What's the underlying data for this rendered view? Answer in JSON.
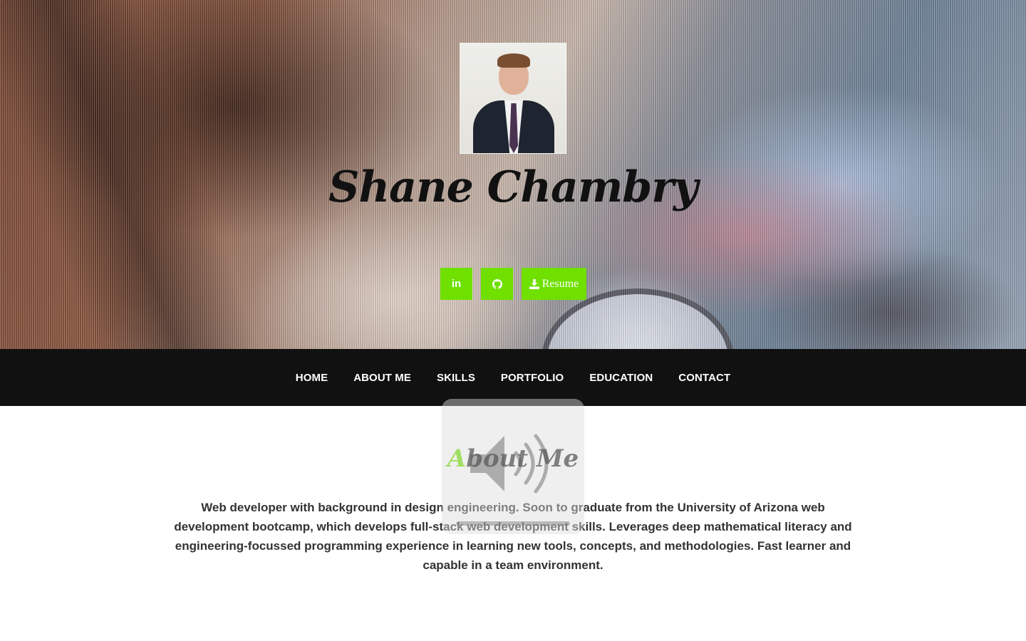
{
  "hero": {
    "name": "Shane Chambry",
    "linkedin_label": "in",
    "resume_label": "Resume",
    "linkedin_icon": "linkedin-icon",
    "github_icon": "github-icon",
    "download_icon": "download-icon"
  },
  "nav": {
    "items": [
      {
        "label": "HOME"
      },
      {
        "label": "ABOUT ME"
      },
      {
        "label": "SKILLS"
      },
      {
        "label": "PORTFOLIO"
      },
      {
        "label": "EDUCATION"
      },
      {
        "label": "CONTACT"
      }
    ]
  },
  "about": {
    "title_first_letter": "A",
    "title_rest": "bout Me",
    "text": "Web developer with background in design engineering. Soon to graduate from the University of Arizona web development bootcamp, which develops full-stack web development skills. Leverages deep mathematical literacy and engineering-focussed programming experience in learning new tools, concepts, and methodologies. Fast learner and capable in a team environment."
  },
  "overlay": {
    "icon": "speaker-volume-icon"
  },
  "colors": {
    "accent": "#6fe000",
    "nav_bg": "#111111",
    "text": "#333333"
  }
}
